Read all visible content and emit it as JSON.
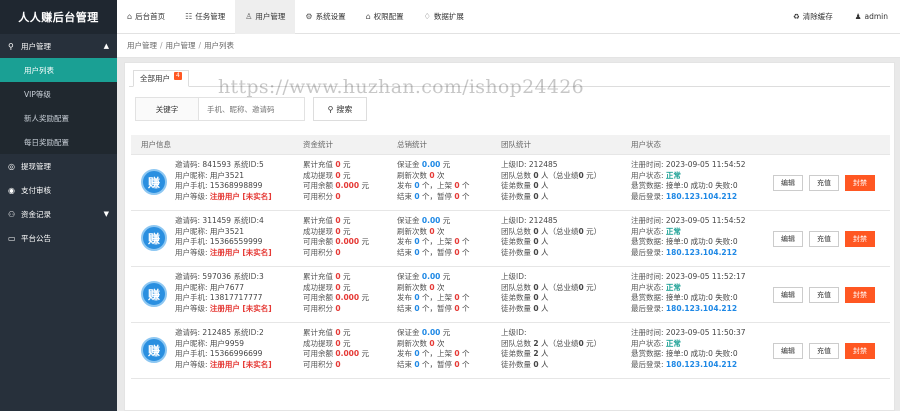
{
  "app_title": "人人赚后台管理",
  "sidebar": {
    "groups": [
      {
        "label": "用户管理",
        "icon": "user-icon",
        "caret": "▲"
      },
      {
        "label": "提现管理",
        "icon": "money-icon"
      },
      {
        "label": "支付审核",
        "icon": "pay-icon"
      },
      {
        "label": "资金记录",
        "icon": "ledger-icon",
        "caret": "▼"
      },
      {
        "label": "平台公告",
        "icon": "notice-icon"
      }
    ],
    "sub_items": [
      "用户列表",
      "VIP等级",
      "新人奖励配置",
      "每日奖励配置"
    ]
  },
  "topnav": {
    "items": [
      {
        "label": "后台首页",
        "icon": "home-icon"
      },
      {
        "label": "任务管理",
        "icon": "task-icon"
      },
      {
        "label": "用户管理",
        "icon": "users-icon"
      },
      {
        "label": "系统设置",
        "icon": "gear-icon"
      },
      {
        "label": "权限配置",
        "icon": "lock-icon"
      },
      {
        "label": "数据扩展",
        "icon": "data-icon"
      }
    ],
    "clear_cache": "清除缓存",
    "admin": "admin"
  },
  "breadcrumb": [
    "用户管理",
    "用户管理",
    "用户列表"
  ],
  "tab": {
    "label": "全部用户",
    "badge": "4"
  },
  "watermark": "https://www.huzhan.com/ishop24426",
  "search": {
    "label": "关键字",
    "placeholder": "手机、昵称、邀请码",
    "button": "搜索"
  },
  "columns": [
    "用户信息",
    "资金统计",
    "总销统计",
    "团队统计",
    "用户状态"
  ],
  "labels": {
    "invite": "邀请码:",
    "system": "系统ID:",
    "nick": "用户昵称:",
    "phone": "用户手机:",
    "level": "用户等级:",
    "recharge": "累计充值",
    "withdraw": "成功提现",
    "balance": "可用余额",
    "points": "可用积分",
    "deposit": "保证金",
    "refresh": "刷新次数",
    "publish": "发布",
    "listed": "上架",
    "finish": "结束",
    "pause": "暂停",
    "yuan": "元",
    "times": "次",
    "count": "个",
    "parent": "上级ID:",
    "team_total": "团队总数",
    "team_perf": "总业绩",
    "direct": "徒弟数量",
    "grand": "徒孙数量",
    "people": "人",
    "reg_time": "注册时间:",
    "status": "用户状态:",
    "task_data": "悬赏数据:",
    "task_data_value": "接单:0 成功:0 失败:0",
    "last_login": "最后登录:",
    "btn_edit": "编辑",
    "btn_recharge": "充值",
    "btn_ban": "封禁",
    "avatar_text": "赚"
  },
  "users": [
    {
      "invite": "841593",
      "sysid": "5",
      "nick": "用户3521",
      "phone": "15368998899",
      "level": "注册用户",
      "realname": "[未实名]",
      "recharge": "0",
      "withdraw": "0",
      "balance": "0.000",
      "points": "0",
      "deposit": "0.00",
      "refresh": "0",
      "publish": "0",
      "listed": "0",
      "finish": "0",
      "pause": "0",
      "parent": "212485",
      "team": "0",
      "team_perf": "0",
      "direct": "0",
      "grand": "0",
      "reg": "2023-09-05 11:54:52",
      "status": "正常",
      "ip": "180.123.104.212"
    },
    {
      "invite": "311459",
      "sysid": "4",
      "nick": "用户3521",
      "phone": "15366559999",
      "level": "注册用户",
      "realname": "[未实名]",
      "recharge": "0",
      "withdraw": "0",
      "balance": "0.000",
      "points": "0",
      "deposit": "0.00",
      "refresh": "0",
      "publish": "0",
      "listed": "0",
      "finish": "0",
      "pause": "0",
      "parent": "212485",
      "team": "0",
      "team_perf": "0",
      "direct": "0",
      "grand": "0",
      "reg": "2023-09-05 11:54:52",
      "status": "正常",
      "ip": "180.123.104.212"
    },
    {
      "invite": "597036",
      "sysid": "3",
      "nick": "用户7677",
      "phone": "13817717777",
      "level": "注册用户",
      "realname": "[未实名]",
      "recharge": "0",
      "withdraw": "0",
      "balance": "0.000",
      "points": "0",
      "deposit": "0.00",
      "refresh": "0",
      "publish": "0",
      "listed": "0",
      "finish": "0",
      "pause": "0",
      "parent": "",
      "team": "0",
      "team_perf": "0",
      "direct": "0",
      "grand": "0",
      "reg": "2023-09-05 11:52:17",
      "status": "正常",
      "ip": "180.123.104.212"
    },
    {
      "invite": "212485",
      "sysid": "2",
      "nick": "用户9959",
      "phone": "15366996699",
      "level": "注册用户",
      "realname": "[未实名]",
      "recharge": "0",
      "withdraw": "0",
      "balance": "0.000",
      "points": "0",
      "deposit": "0.00",
      "refresh": "0",
      "publish": "0",
      "listed": "0",
      "finish": "0",
      "pause": "0",
      "parent": "",
      "team": "2",
      "team_perf": "0",
      "direct": "2",
      "grand": "0",
      "reg": "2023-09-05 11:50:37",
      "status": "正常",
      "ip": "180.123.104.212"
    }
  ]
}
